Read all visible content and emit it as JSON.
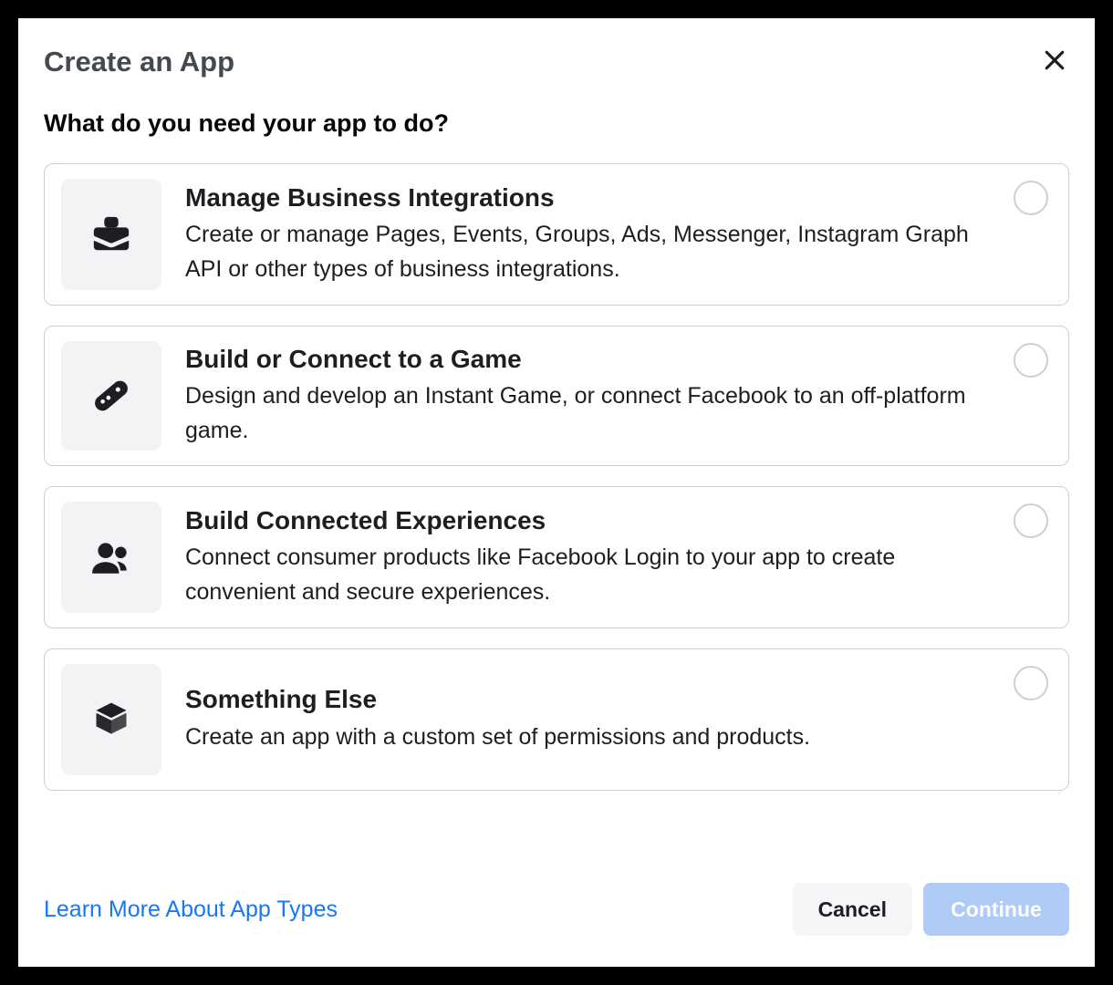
{
  "modal": {
    "title": "Create an App",
    "subtitle": "What do you need your app to do?"
  },
  "options": [
    {
      "icon": "briefcase-icon",
      "title": "Manage Business Integrations",
      "desc": "Create or manage Pages, Events, Groups, Ads, Messenger, Instagram Graph API or other types of business integrations."
    },
    {
      "icon": "gamepad-icon",
      "title": "Build or Connect to a Game",
      "desc": "Design and develop an Instant Game, or connect Facebook to an off-platform game."
    },
    {
      "icon": "users-icon",
      "title": "Build Connected Experiences",
      "desc": "Connect consumer products like Facebook Login to your app to create convenient and secure experiences."
    },
    {
      "icon": "cube-icon",
      "title": "Something Else",
      "desc": "Create an app with a custom set of permissions and products."
    }
  ],
  "footer": {
    "learn_link": "Learn More About App Types",
    "cancel_label": "Cancel",
    "continue_label": "Continue"
  }
}
